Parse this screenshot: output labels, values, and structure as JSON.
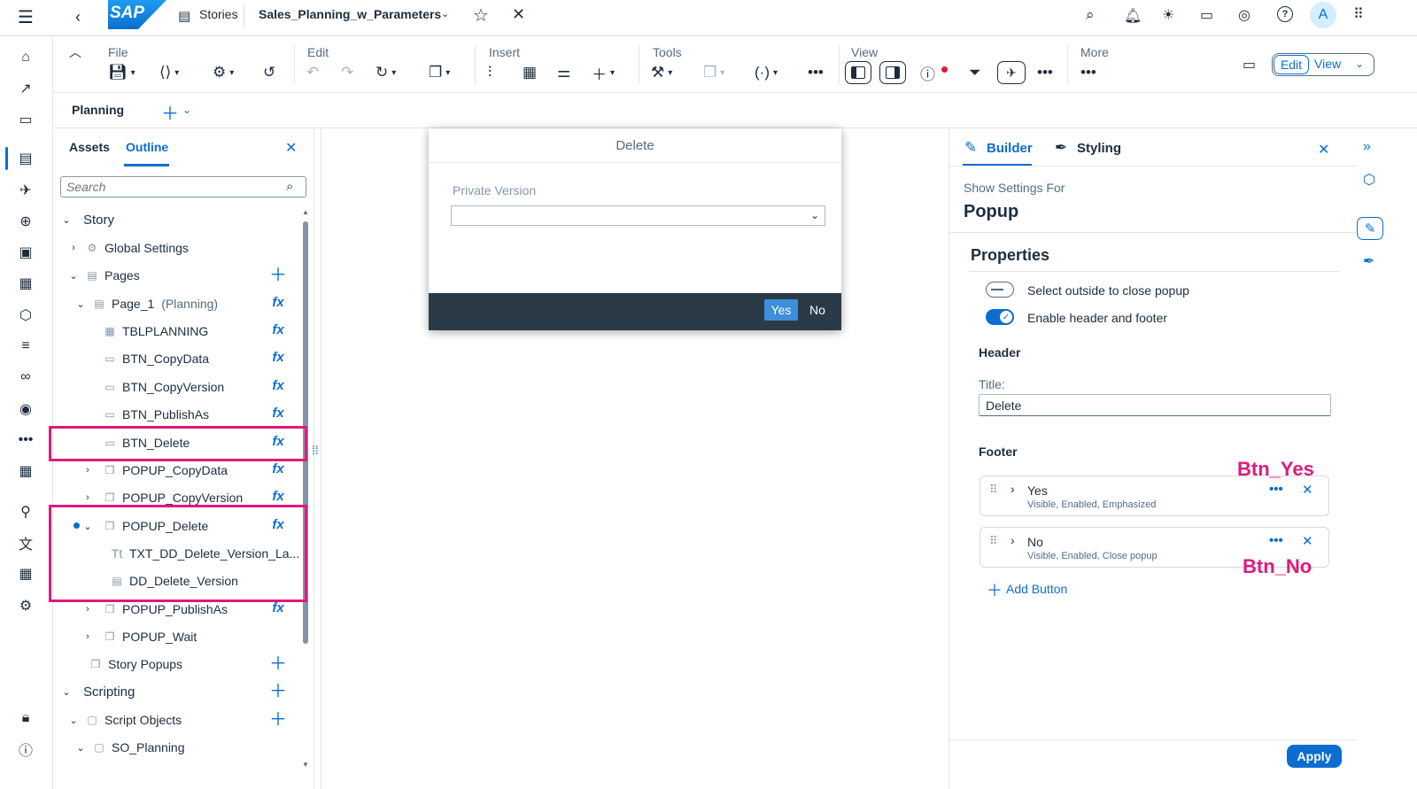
{
  "shell": {
    "logo_text": "SAP",
    "stories_label": "Stories",
    "story_title": "Sales_Planning_w_Parameters",
    "avatar_initial": "A"
  },
  "toolbar": {
    "file": "File",
    "edit": "Edit",
    "insert": "Insert",
    "tools": "Tools",
    "view": "View",
    "more": "More",
    "edit_btn": "Edit",
    "view_btn": "View"
  },
  "pagebar": {
    "page_label": "Planning"
  },
  "outline": {
    "tabs": [
      "Assets",
      "Outline"
    ],
    "active_tab": "Outline",
    "search_placeholder": "Search",
    "items": [
      {
        "label": "Story"
      },
      {
        "label": "Global Settings"
      },
      {
        "label": "Pages"
      },
      {
        "label": "Page_1",
        "suffix": "(Planning)"
      },
      {
        "label": "TBLPLANNING"
      },
      {
        "label": "BTN_CopyData"
      },
      {
        "label": "BTN_CopyVersion"
      },
      {
        "label": "BTN_PublishAs"
      },
      {
        "label": "BTN_Delete"
      },
      {
        "label": "POPUP_CopyData"
      },
      {
        "label": "POPUP_CopyVersion"
      },
      {
        "label": "POPUP_Delete"
      },
      {
        "label": "TXT_DD_Delete_Version_La..."
      },
      {
        "label": "DD_Delete_Version"
      },
      {
        "label": "POPUP_PublishAs"
      },
      {
        "label": "POPUP_Wait"
      },
      {
        "label": "Story Popups"
      },
      {
        "label": "Scripting"
      },
      {
        "label": "Script Objects"
      },
      {
        "label": "SO_Planning"
      }
    ]
  },
  "popup": {
    "title": "Delete",
    "field_label": "Private Version",
    "yes": "Yes",
    "no": "No"
  },
  "builder": {
    "tab_builder": "Builder",
    "tab_styling": "Styling",
    "show_settings_for": "Show Settings For",
    "widget_name": "Popup",
    "properties": "Properties",
    "opt_select_outside": "Select outside to close popup",
    "opt_header_footer": "Enable header and footer",
    "header": "Header",
    "title_label": "Title:",
    "title_value": "Delete",
    "footer": "Footer",
    "buttons": [
      {
        "name": "Yes",
        "desc": "Visible, Enabled, Emphasized"
      },
      {
        "name": "No",
        "desc": "Visible, Enabled, Close popup"
      }
    ],
    "add_button": "Add Button",
    "apply": "Apply"
  },
  "annotations": {
    "btn_yes": "Btn_Yes",
    "btn_no": "Btn_No"
  },
  "colors": {
    "accent": "#0a6ed1",
    "highlight": "#e0197d",
    "popup_footer": "#2b3a47"
  }
}
